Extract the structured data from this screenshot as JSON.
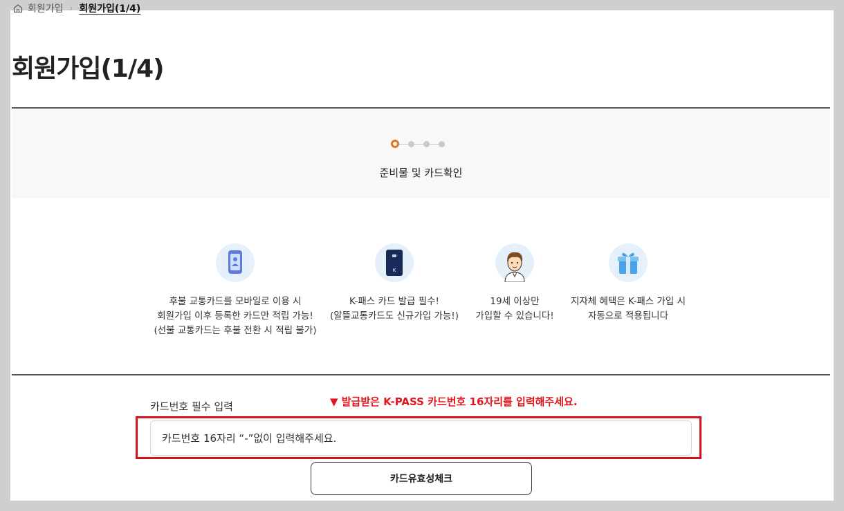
{
  "breadcrumb": {
    "home_icon": "home-icon",
    "parent": "회원가입",
    "current": "회원가입(1/4)"
  },
  "page_title": "회원가입(1/4)",
  "stepper": {
    "total_steps": 4,
    "current_step": 1,
    "active_color": "#e8731d",
    "label": "준비물 및 카드확인"
  },
  "features": [
    {
      "icon": "mobile-card-icon",
      "lines": [
        "후불 교통카드를 모바일로 이용 시",
        "회원가입 이후 등록한 카드만 적립 가능!",
        "(선불 교통카드는 후불 전환 시 적립 불가)"
      ]
    },
    {
      "icon": "kpass-card-icon",
      "lines": [
        "K-패스 카드 발급 필수!",
        "(알뜰교통카드도 신규가입 가능!)"
      ]
    },
    {
      "icon": "person-avatar-icon",
      "lines": [
        "19세 이상만",
        "가입할 수 있습니다!"
      ]
    },
    {
      "icon": "gift-icon",
      "lines": [
        "지자체 혜택은 K-패스 가입 시",
        "자동으로 적용됩니다"
      ]
    }
  ],
  "card_form": {
    "label": "카드번호 필수 입력",
    "notice": "▼ 발급받은 K-PASS 카드번호 16자리를 입력해주세요.",
    "notice_color": "#e3151c",
    "input_placeholder": "카드번호 16자리 “-”없이 입력해주세요.",
    "input_value": "",
    "check_button": "카드유효성체크"
  }
}
